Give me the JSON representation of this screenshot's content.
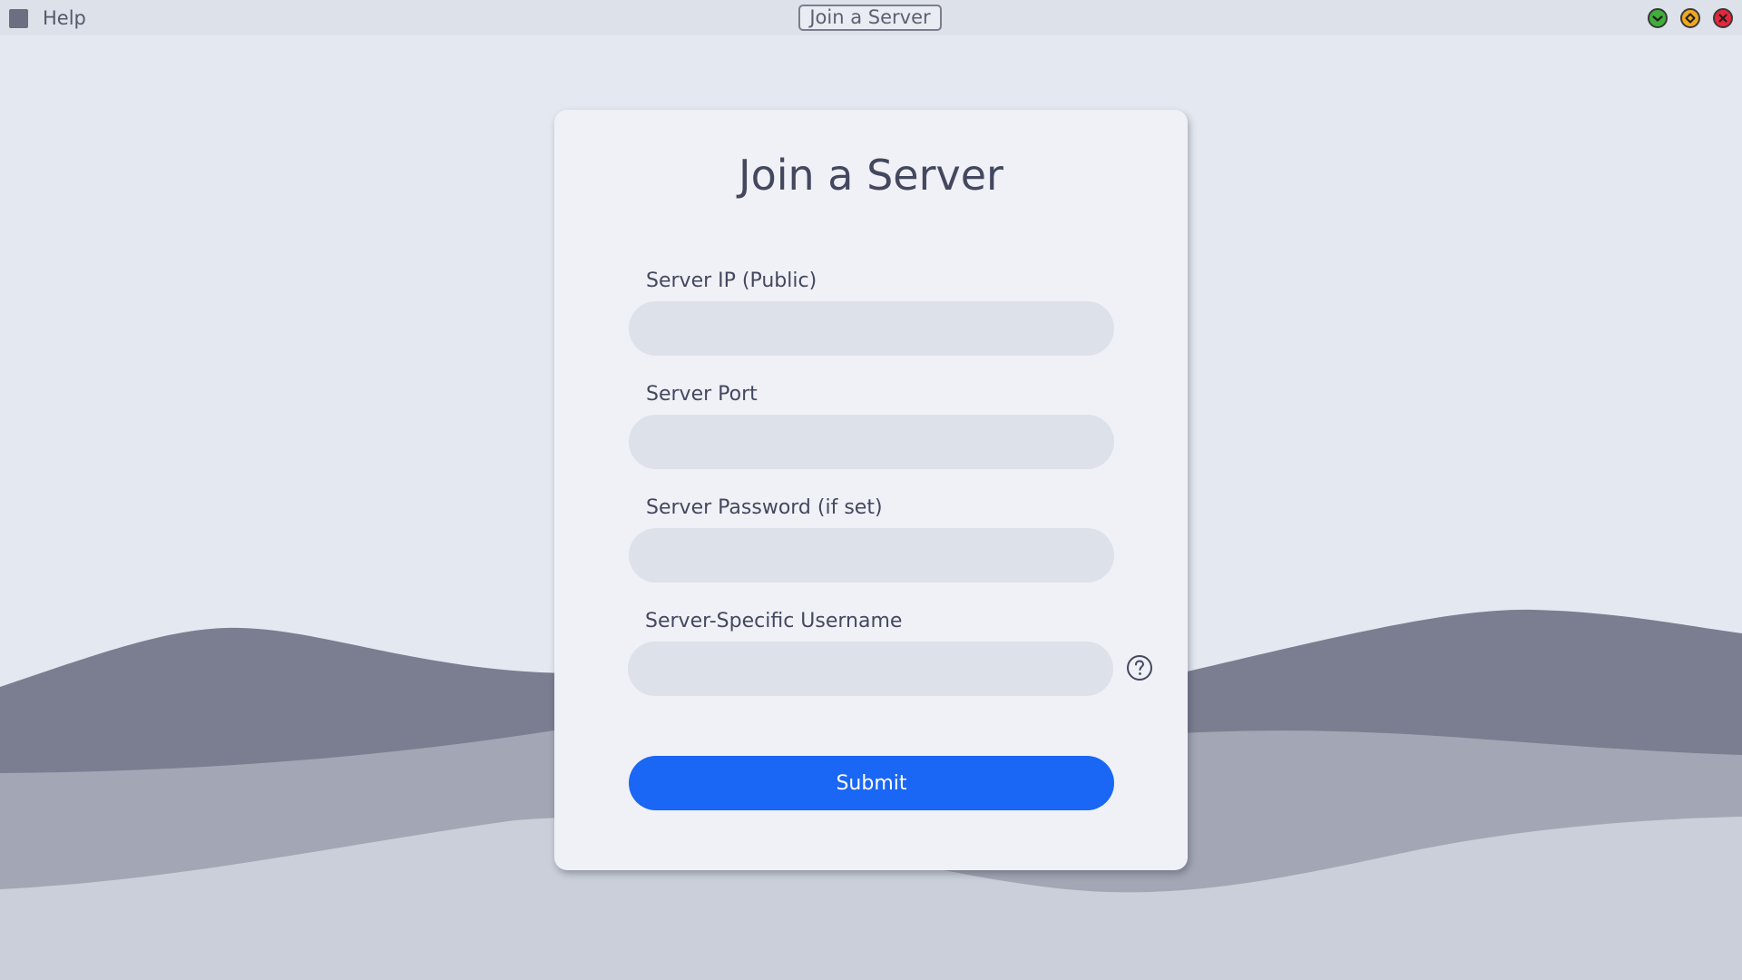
{
  "titlebar": {
    "app_icon": "app-square-icon",
    "help_label": "Help",
    "window_title": "Join a Server",
    "controls": {
      "minimize_icon": "check-circle-icon",
      "maximize_icon": "diamond-circle-icon",
      "close_icon": "x-circle-icon"
    }
  },
  "form": {
    "title": "Join a Server",
    "fields": [
      {
        "label": "Server IP (Public)",
        "value": "",
        "placeholder": ""
      },
      {
        "label": "Server Port",
        "value": "",
        "placeholder": ""
      },
      {
        "label": "Server Password (if set)",
        "value": "",
        "placeholder": ""
      },
      {
        "label": "Server-Specific Username",
        "value": "",
        "placeholder": ""
      }
    ],
    "help_icon": "question-circle-icon",
    "submit_label": "Submit"
  },
  "colors": {
    "accent": "#1a66f5",
    "background": "#e4e8f0",
    "card": "#eff1f6",
    "input": "#dde1e9",
    "text": "#43485f",
    "wave_dark": "#7b7e90",
    "wave_mid": "#a3a6b4",
    "wave_light": "#cbcfda"
  }
}
